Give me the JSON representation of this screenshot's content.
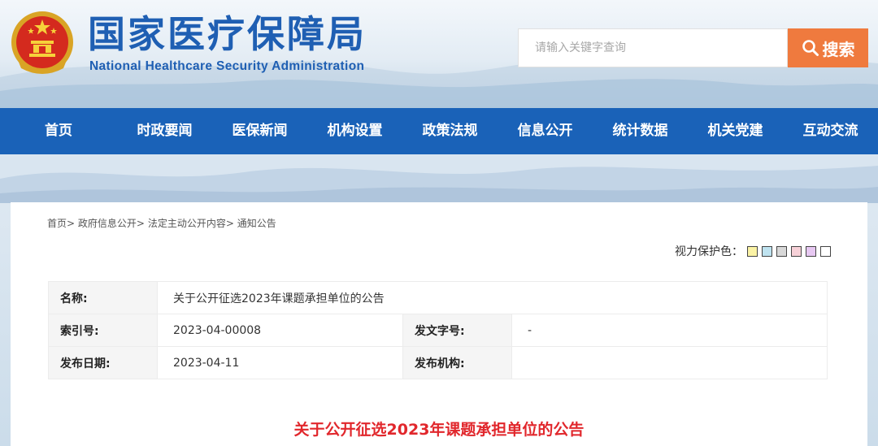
{
  "header": {
    "title_cn": "国家医疗保障局",
    "title_en": "National Healthcare Security Administration",
    "search_placeholder": "请输入关键字查询",
    "search_button": "搜索"
  },
  "nav": {
    "items": [
      "首页",
      "时政要闻",
      "医保新闻",
      "机构设置",
      "政策法规",
      "信息公开",
      "统计数据",
      "机关党建",
      "互动交流"
    ]
  },
  "breadcrumb": {
    "items": [
      "首页",
      "政府信息公开",
      "法定主动公开内容",
      "通知公告"
    ],
    "separator": ">"
  },
  "eye_care": {
    "label": "视力保护色：",
    "swatches": [
      "#fbf3a5",
      "#bfe3f0",
      "#d8d8d8",
      "#f7d1d8",
      "#e7c8f2",
      "#ffffff"
    ]
  },
  "info_table": {
    "name_label": "名称:",
    "name_value": "关于公开征选2023年课题承担单位的公告",
    "index_label": "索引号:",
    "index_value": "2023-04-00008",
    "doc_number_label": "发文字号:",
    "doc_number_value": "-",
    "date_label": "发布日期:",
    "date_value": "2023-04-11",
    "org_label": "发布机构:",
    "org_value": ""
  },
  "document": {
    "title": "关于公开征选2023年课题承担单位的公告"
  },
  "colors": {
    "nav_bg": "#1a62b8",
    "brand_blue": "#1f5fb3",
    "search_button": "#ef7a3e",
    "doc_title": "#e1272c"
  }
}
